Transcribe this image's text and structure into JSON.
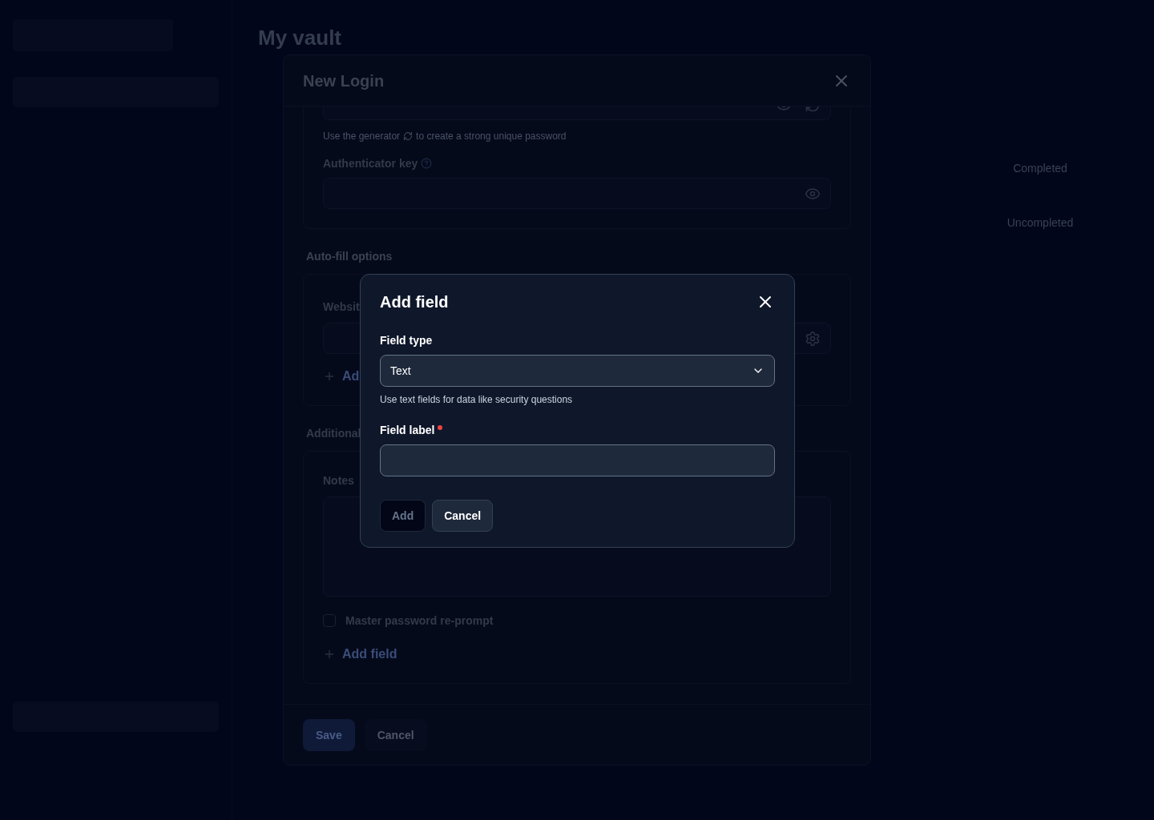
{
  "app": {
    "page_title": "My vault",
    "filters": [
      {
        "label": "Completed"
      },
      {
        "label": "Uncompleted"
      }
    ]
  },
  "login_dialog": {
    "title": "New Login",
    "password_hint_before": "Use the generator",
    "password_hint_after": "to create a strong unique password",
    "authenticator_label": "Authenticator key",
    "autofill_heading": "Auto-fill options",
    "website_label": "Websit",
    "add_website": "Ad",
    "additional_heading": "Additional",
    "notes_label": "Notes",
    "reprompt": {
      "label": "Master password re-prompt",
      "checked": false
    },
    "add_field": "Add field",
    "buttons": [
      {
        "label": "Save",
        "kind": "primary"
      },
      {
        "label": "Cancel",
        "kind": "secondary"
      }
    ]
  },
  "add_field_dialog": {
    "title": "Add field",
    "field_type_label": "Field type",
    "field_type_value": "Text",
    "field_type_hint": "Use text fields for data like security questions",
    "field_label_label": "Field label",
    "required": true,
    "buttons": [
      {
        "label": "Add",
        "disabled": true
      },
      {
        "label": "Cancel",
        "disabled": false
      }
    ]
  }
}
